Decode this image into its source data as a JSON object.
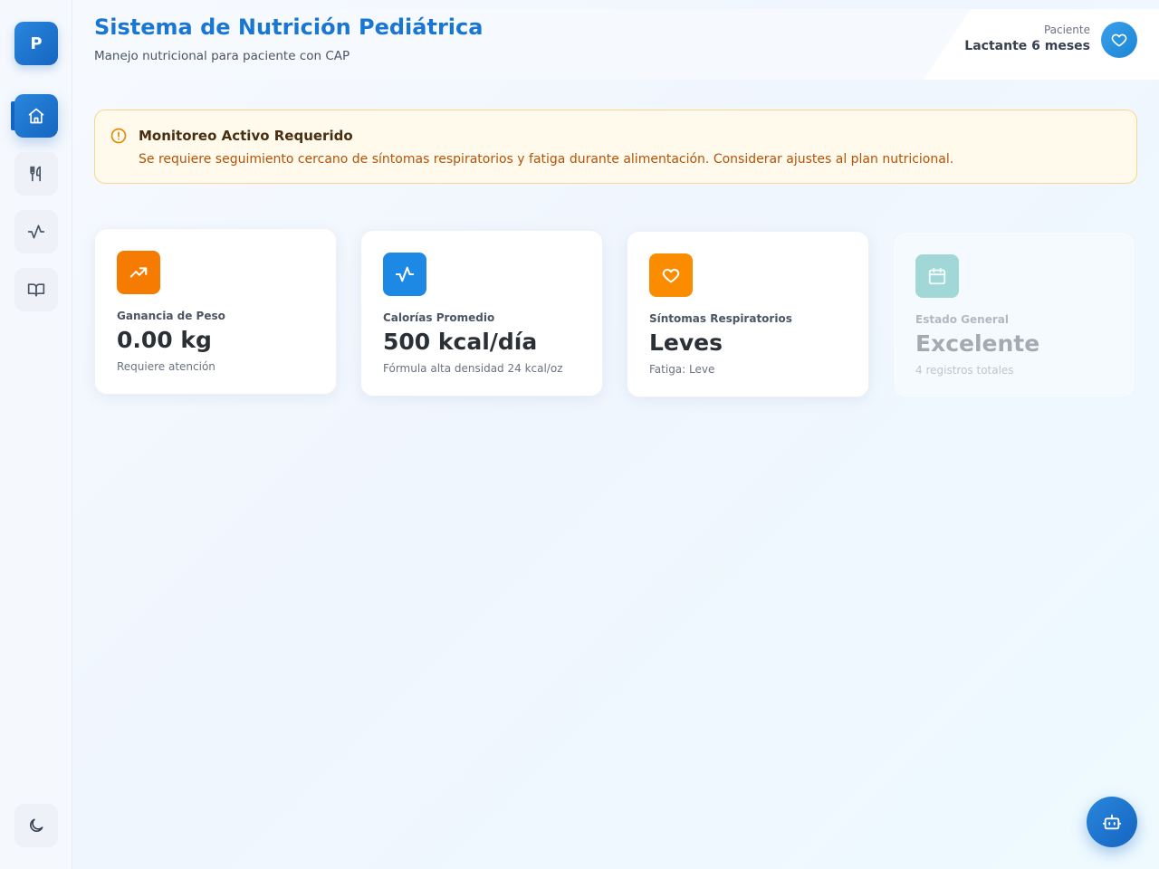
{
  "app": {
    "logo_letter": "P",
    "title": "Sistema de Nutrición Pediátrica",
    "subtitle": "Manejo nutricional para paciente con CAP"
  },
  "patient": {
    "label": "Paciente",
    "value": "Lactante 6 meses"
  },
  "sidebar": {
    "items": [
      {
        "name": "home",
        "icon": "home-icon",
        "active": true
      },
      {
        "name": "nutrition",
        "icon": "utensils-icon",
        "active": false
      },
      {
        "name": "activity",
        "icon": "activity-icon",
        "active": false
      },
      {
        "name": "guide",
        "icon": "book-icon",
        "active": false
      }
    ],
    "theme_icon": "moon-icon"
  },
  "alert": {
    "title": "Monitoreo Activo Requerido",
    "text": "Se requiere seguimiento cercano de síntomas respiratorios y fatiga durante alimentación. Considerar ajustes al plan nutricional."
  },
  "stats": [
    {
      "label": "Ganancia de Peso",
      "value": "0.00 kg",
      "sub": "Requiere atención",
      "icon": "trending-up-icon",
      "color": "#f57c00"
    },
    {
      "label": "Calorías Promedio",
      "value": "500 kcal/día",
      "sub": "Fórmula alta densidad 24 kcal/oz",
      "icon": "activity-icon",
      "color": "#1e88e5"
    },
    {
      "label": "Síntomas Respiratorios",
      "value": "Leves",
      "sub": "Fatiga: Leve",
      "icon": "heart-icon",
      "color": "#fb8c00"
    },
    {
      "label": "Estado General",
      "value": "Excelente",
      "sub": "4 registros totales",
      "icon": "calendar-icon",
      "color": "#26a69a"
    }
  ],
  "colors": {
    "accent": "#1976d2",
    "alert_bg": "#fffaeb",
    "alert_text": "#b45309"
  },
  "assistant_button_icon": "bot-icon"
}
